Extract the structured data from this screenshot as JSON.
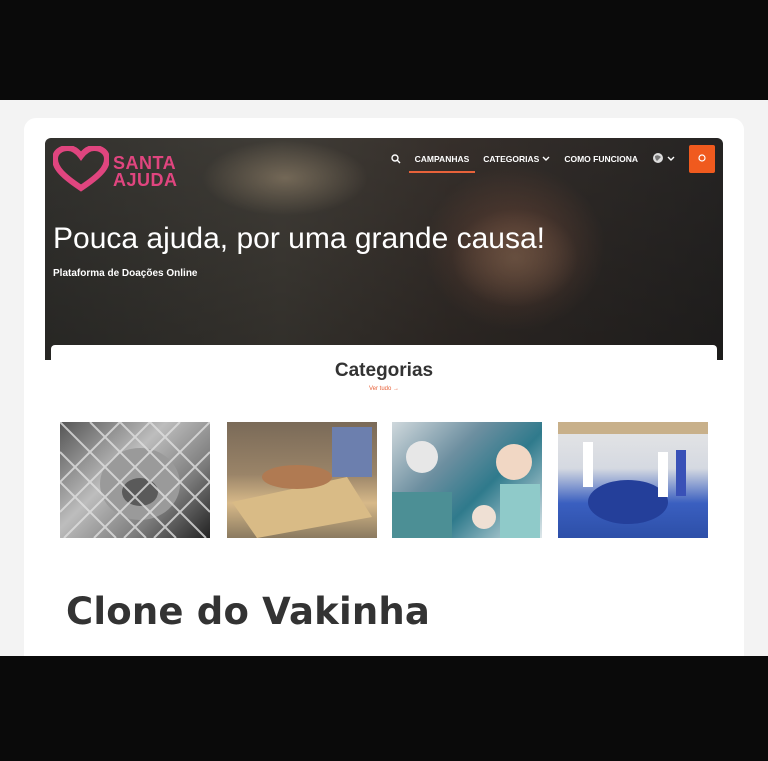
{
  "header": {
    "logo_text_line1": "SANTA",
    "logo_text_line2": "AJUDA",
    "nav": {
      "campaigns": "CAMPANHAS",
      "categories": "CATEGORIAS",
      "how_it_works": "COMO FUNCIONA"
    }
  },
  "hero": {
    "title": "Pouca ajuda, por uma grande causa!",
    "subtitle": "Plataforma de Doações Online"
  },
  "categories_section": {
    "title": "Categorias",
    "see_all": "Ver tudo →"
  },
  "caption": {
    "text": "Clone do Vakinha"
  },
  "colors": {
    "accent": "#f05a1e",
    "brand": "#e0457f"
  }
}
